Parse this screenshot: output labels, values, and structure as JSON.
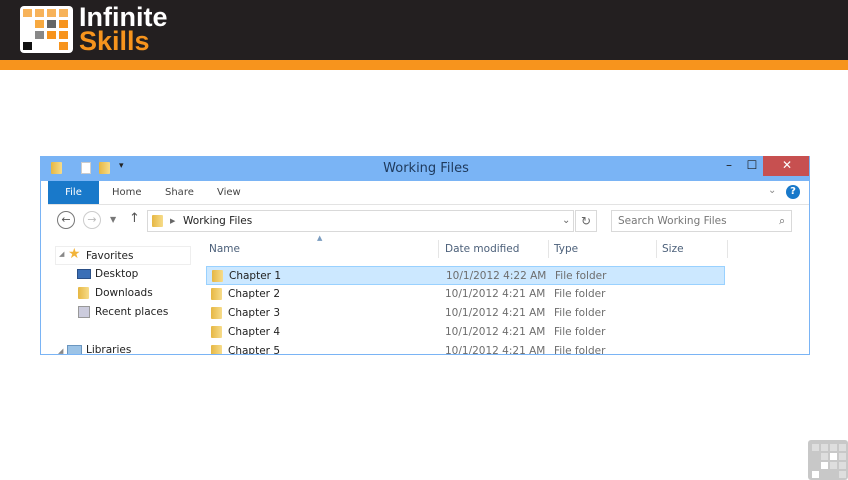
{
  "brand": {
    "line1": "Infinite",
    "line2": "Skills",
    "accent": "#f7941d"
  },
  "window": {
    "title": "Working Files",
    "controls": {
      "minimize": "–",
      "maximize": "☐",
      "close": "✕"
    }
  },
  "ribbon": {
    "tabs": [
      "File",
      "Home",
      "Share",
      "View"
    ],
    "help": "?"
  },
  "address": {
    "path": "Working Files",
    "search_placeholder": "Search Working Files"
  },
  "sidebar": {
    "favorites": "Favorites",
    "items": [
      "Desktop",
      "Downloads",
      "Recent places"
    ],
    "libraries": "Libraries"
  },
  "columns": [
    "Name",
    "Date modified",
    "Type",
    "Size"
  ],
  "rows": [
    {
      "name": "Chapter 1",
      "date": "10/1/2012 4:22 AM",
      "type": "File folder"
    },
    {
      "name": "Chapter 2",
      "date": "10/1/2012 4:21 AM",
      "type": "File folder"
    },
    {
      "name": "Chapter 3",
      "date": "10/1/2012 4:21 AM",
      "type": "File folder"
    },
    {
      "name": "Chapter 4",
      "date": "10/1/2012 4:21 AM",
      "type": "File folder"
    },
    {
      "name": "Chapter 5",
      "date": "10/1/2012 4:21 AM",
      "type": "File folder"
    }
  ]
}
